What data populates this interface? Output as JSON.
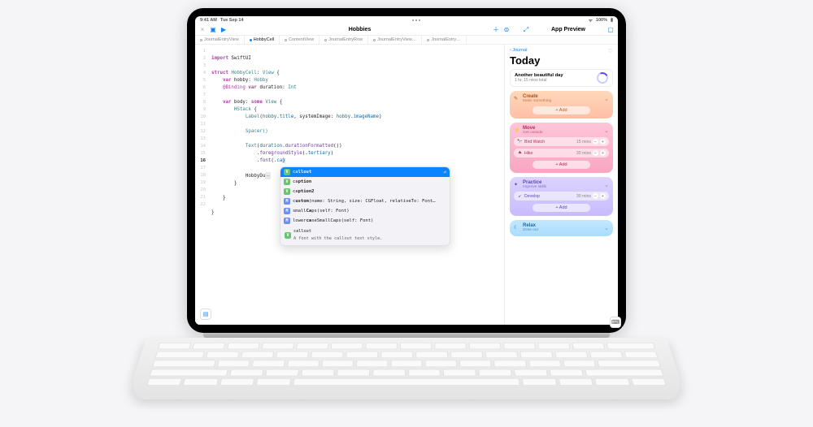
{
  "status": {
    "time": "9:41 AM",
    "date": "Tue Sep 14",
    "battery": "100%"
  },
  "toolbar": {
    "title": "Hobbies"
  },
  "tabs": [
    {
      "label": "JournalEntryView",
      "active": false
    },
    {
      "label": "HobbyCell",
      "active": true
    },
    {
      "label": "ContentView",
      "active": false
    },
    {
      "label": "JournalEntryRow",
      "active": false
    },
    {
      "label": "JournalEntryView…",
      "active": false
    },
    {
      "label": "JournalEntry…",
      "active": false
    }
  ],
  "gutter": [
    "1",
    "2",
    "3",
    "4",
    "5",
    "6",
    "7",
    "8",
    "9",
    "10",
    "11",
    "12",
    "13",
    "14",
    "15",
    "16",
    "17",
    "18",
    "",
    "19",
    "20",
    "",
    "21",
    "22"
  ],
  "activeLine": "16",
  "code": {
    "l1a": "import",
    "l1b": " SwiftUI",
    "l3a": "struct",
    "l3b": " HobbyCell",
    "l3c": ": ",
    "l3d": "View",
    "l3e": " {",
    "l4a": "    var",
    "l4b": " hobby: ",
    "l4c": "Hobby",
    "l5a": "    @Binding",
    "l5b": " var",
    "l5c": " duration: ",
    "l5d": "Int",
    "l7a": "    var",
    "l7b": " body: ",
    "l7c": "some",
    "l7d": " View",
    "l7e": " {",
    "l8a": "        HStack",
    "l8b": " {",
    "l9a": "            Label",
    "l9b": "(",
    "l9c": "hobby",
    "l9d": ".",
    "l9e": "title",
    "l9f": ", systemImage: ",
    "l9g": "hobby",
    "l9h": ".",
    "l9i": "imageName",
    "l9j": ")",
    "l11": "            Spacer()",
    "l13a": "            Text",
    "l13b": "(",
    "l13c": "duration",
    "l13d": ".",
    "l13e": "durationFormatted",
    "l13f": "())",
    "l14a": "                .",
    "l14b": "foregroundStyle",
    "l14c": "(.",
    "l14d": "tertiary",
    "l14e": ")",
    "l15a": "                .",
    "l15b": "font",
    "l15c": "(.",
    "l15d": "ca",
    "l15e": ")",
    "l17a": "            HobbyDu",
    "l17b": "…",
    "l18": "        }",
    "l20": "    }",
    "l22": "}"
  },
  "autocomplete": {
    "items": [
      {
        "badge": "V",
        "bcls": "bg-v",
        "pre": "ca",
        "match": "llout",
        "selected": true
      },
      {
        "badge": "V",
        "bcls": "bg-v",
        "pre": "ca",
        "match": "ption"
      },
      {
        "badge": "V",
        "bcls": "bg-v",
        "pre": "ca",
        "match": "ption2"
      },
      {
        "badge": "M",
        "bcls": "bg-m",
        "pre": "c",
        "match": "ustom",
        "post": "(name: String, size: CGFloat, relativeTo: Font…"
      },
      {
        "badge": "M",
        "bcls": "bg-m",
        "pre": "small",
        "match": "Ca",
        "post": "ps(self: Font)"
      },
      {
        "badge": "M",
        "bcls": "bg-m",
        "pre": "lower",
        "match": "ca",
        "post": "seSmallCaps(self: Font)"
      }
    ],
    "doc_title": "callout",
    "doc_text": "A font with the callout text style."
  },
  "preview": {
    "header": "App Preview",
    "breadcrumb": "Journal",
    "title": "Today",
    "summary": {
      "line1": "Another beautiful day",
      "line2": "1 hr, 15 mins total"
    },
    "cards": [
      {
        "cls": "card-create",
        "icon": "✎",
        "title": "Create",
        "sub": "Make something",
        "rows": [],
        "add": "+  Add"
      },
      {
        "cls": "card-move",
        "icon": "⚡",
        "title": "Move",
        "sub": "Get outside",
        "rows": [
          {
            "icon": "🔭",
            "label": "Bird Watch",
            "dur": "15 mins"
          },
          {
            "icon": "⛰",
            "label": "Hike",
            "dur": "30 mins"
          }
        ],
        "add": "+  Add"
      },
      {
        "cls": "card-practice",
        "icon": "✦",
        "title": "Practice",
        "sub": "Improve skills",
        "rows": [
          {
            "icon": "➹",
            "label": "Develop",
            "dur": "30 mins"
          }
        ],
        "add": "+  Add"
      },
      {
        "cls": "card-relax",
        "icon": "☾",
        "title": "Relax",
        "sub": "Zone out",
        "rows": [],
        "add": ""
      }
    ]
  }
}
